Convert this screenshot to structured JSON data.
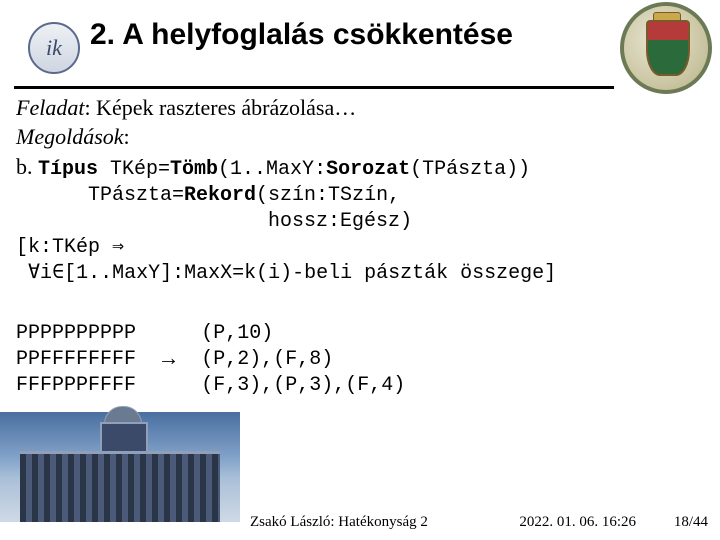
{
  "header": {
    "title": "2. A helyfoglalás csökkentése",
    "logo_left_text": "ik"
  },
  "task": {
    "label": "Feladat",
    "text": ": Képek raszteres ábrázolása…"
  },
  "solutions_label": "Megoldások",
  "item_b": {
    "bullet": "b.",
    "kw_type": "Típus",
    "line1_pre": " TKép=",
    "kw_tomb": "Tömb",
    "line1_mid": "(1..MaxY:",
    "kw_sorozat": "Sorozat",
    "line1_post": "(TPászta))",
    "line2_pre": "      TPászta=",
    "kw_rekord": "Rekord",
    "line2_post": "(szín:TSzín,",
    "line3": "                     hossz:Egész)",
    "line4": "[k:TKép ⇒",
    "line5": " ∀i∈[1..MaxY]:MaxX=k(i)-beli pászták összege]"
  },
  "example": {
    "left": "PPPPPPPPPP\nPPFFFFFFFF\nFFFPPPFFFF",
    "arrow": "→",
    "right": "(P,10)\n(P,2),(F,8)\n(F,3),(P,3),(F,4)"
  },
  "footer": {
    "author": "Zsakó László: Hatékonyság 2",
    "date": "2022. 01. 06. 16:26",
    "page": "18/44"
  }
}
